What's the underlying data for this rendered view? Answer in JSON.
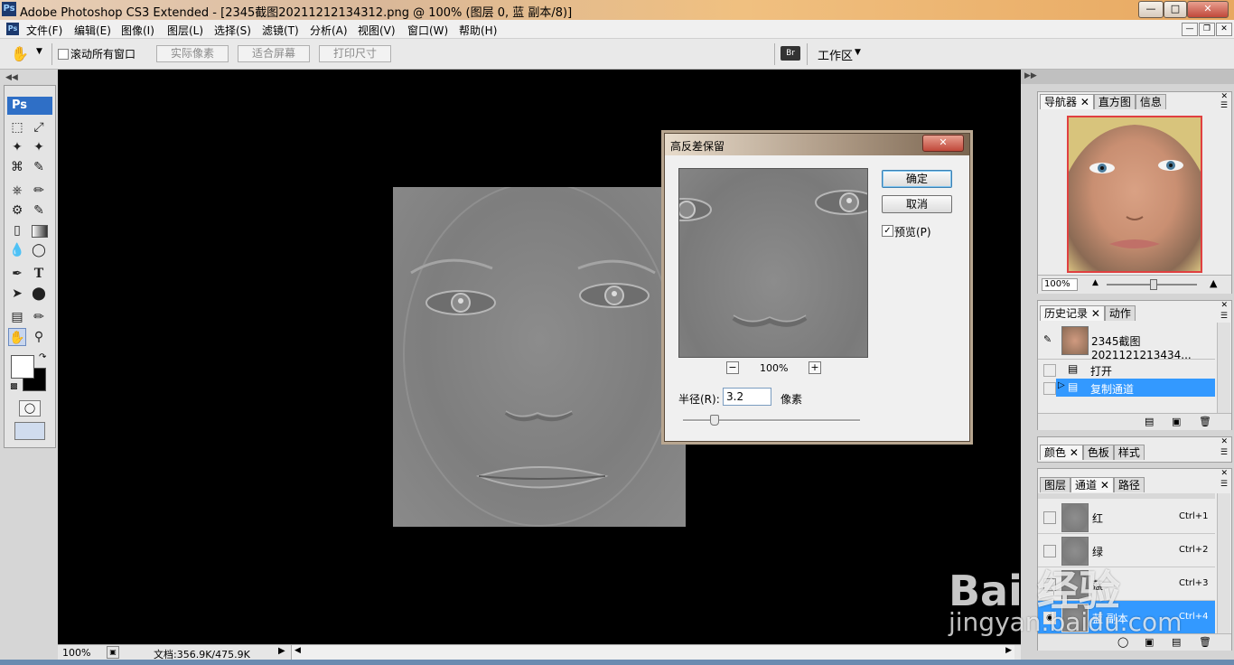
{
  "window": {
    "title": "Adobe Photoshop CS3 Extended - [2345截图20211212134312.png @ 100% (图层 0, 蓝 副本/8)]",
    "app_logo": "Ps"
  },
  "menu": {
    "items": [
      "文件(F)",
      "编辑(E)",
      "图像(I)",
      "图层(L)",
      "选择(S)",
      "滤镜(T)",
      "分析(A)",
      "视图(V)",
      "窗口(W)",
      "帮助(H)"
    ]
  },
  "options": {
    "scroll_all_label": "滚动所有窗口",
    "actual_pixels": "实际像素",
    "fit_screen": "适合屏幕",
    "print_size": "打印尺寸",
    "workspace": "工作区"
  },
  "toolbox": {
    "logo": "Ps"
  },
  "status": {
    "zoom": "100%",
    "doc_info": "文档:356.9K/475.9K"
  },
  "navigator": {
    "tabs": [
      "导航器",
      "直方图",
      "信息"
    ],
    "zoom": "100%"
  },
  "history": {
    "tabs": [
      "历史记录",
      "动作"
    ],
    "snapshot_name": "2345截图2021121213434...",
    "steps": [
      "打开",
      "复制通道"
    ],
    "selected_index": 1
  },
  "color_panel": {
    "tabs": [
      "颜色",
      "色板",
      "样式"
    ]
  },
  "channels": {
    "tabs": [
      "图层",
      "通道",
      "路径"
    ],
    "rows": [
      {
        "name": "红",
        "shortcut": "Ctrl+1"
      },
      {
        "name": "绿",
        "shortcut": "Ctrl+2"
      },
      {
        "name": "蓝",
        "shortcut": "Ctrl+3"
      },
      {
        "name": "蓝 副本",
        "shortcut": "Ctrl+4"
      }
    ]
  },
  "dialog": {
    "title": "高反差保留",
    "ok": "确定",
    "cancel": "取消",
    "preview_label": "预览(P)",
    "preview_checked": true,
    "zoom": "100%",
    "radius_label": "半径(R):",
    "radius_value": "3.2",
    "unit": "像素"
  },
  "watermark": {
    "brand": "Bai 经验",
    "url": "jingyan.baidu.com"
  }
}
